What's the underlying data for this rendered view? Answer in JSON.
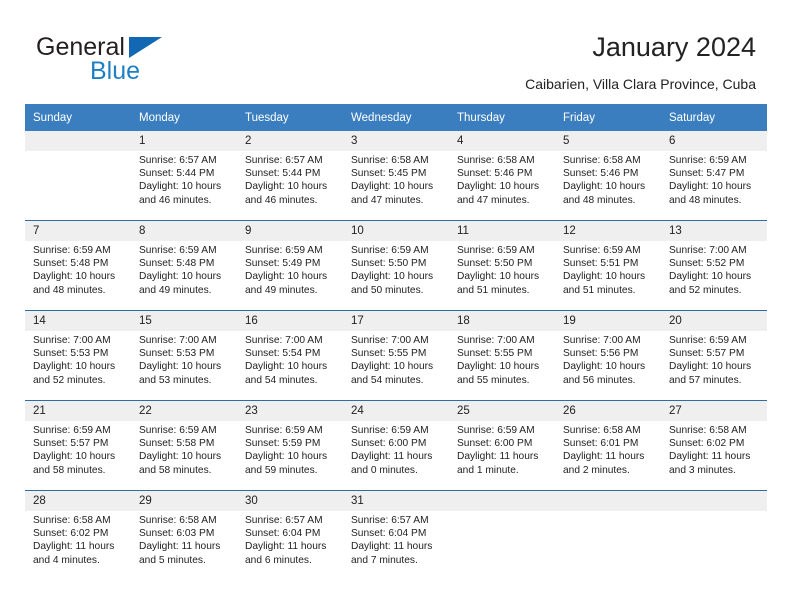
{
  "brand": {
    "name_part1": "General",
    "name_part2": "Blue",
    "accent_color": "#1f7fc4",
    "triangle_color": "#1268b3"
  },
  "header": {
    "title": "January 2024",
    "subtitle": "Caibarien, Villa Clara Province, Cuba"
  },
  "calendar": {
    "header_bg": "#3a7ebf",
    "daynum_bg": "#efefef",
    "row_border": "#2e6da4",
    "weekdays": [
      "Sunday",
      "Monday",
      "Tuesday",
      "Wednesday",
      "Thursday",
      "Friday",
      "Saturday"
    ],
    "weeks": [
      [
        {
          "day": "",
          "sunrise": "",
          "sunset": "",
          "daylight1": "",
          "daylight2": ""
        },
        {
          "day": "1",
          "sunrise": "Sunrise: 6:57 AM",
          "sunset": "Sunset: 5:44 PM",
          "daylight1": "Daylight: 10 hours",
          "daylight2": "and 46 minutes."
        },
        {
          "day": "2",
          "sunrise": "Sunrise: 6:57 AM",
          "sunset": "Sunset: 5:44 PM",
          "daylight1": "Daylight: 10 hours",
          "daylight2": "and 46 minutes."
        },
        {
          "day": "3",
          "sunrise": "Sunrise: 6:58 AM",
          "sunset": "Sunset: 5:45 PM",
          "daylight1": "Daylight: 10 hours",
          "daylight2": "and 47 minutes."
        },
        {
          "day": "4",
          "sunrise": "Sunrise: 6:58 AM",
          "sunset": "Sunset: 5:46 PM",
          "daylight1": "Daylight: 10 hours",
          "daylight2": "and 47 minutes."
        },
        {
          "day": "5",
          "sunrise": "Sunrise: 6:58 AM",
          "sunset": "Sunset: 5:46 PM",
          "daylight1": "Daylight: 10 hours",
          "daylight2": "and 48 minutes."
        },
        {
          "day": "6",
          "sunrise": "Sunrise: 6:59 AM",
          "sunset": "Sunset: 5:47 PM",
          "daylight1": "Daylight: 10 hours",
          "daylight2": "and 48 minutes."
        }
      ],
      [
        {
          "day": "7",
          "sunrise": "Sunrise: 6:59 AM",
          "sunset": "Sunset: 5:48 PM",
          "daylight1": "Daylight: 10 hours",
          "daylight2": "and 48 minutes."
        },
        {
          "day": "8",
          "sunrise": "Sunrise: 6:59 AM",
          "sunset": "Sunset: 5:48 PM",
          "daylight1": "Daylight: 10 hours",
          "daylight2": "and 49 minutes."
        },
        {
          "day": "9",
          "sunrise": "Sunrise: 6:59 AM",
          "sunset": "Sunset: 5:49 PM",
          "daylight1": "Daylight: 10 hours",
          "daylight2": "and 49 minutes."
        },
        {
          "day": "10",
          "sunrise": "Sunrise: 6:59 AM",
          "sunset": "Sunset: 5:50 PM",
          "daylight1": "Daylight: 10 hours",
          "daylight2": "and 50 minutes."
        },
        {
          "day": "11",
          "sunrise": "Sunrise: 6:59 AM",
          "sunset": "Sunset: 5:50 PM",
          "daylight1": "Daylight: 10 hours",
          "daylight2": "and 51 minutes."
        },
        {
          "day": "12",
          "sunrise": "Sunrise: 6:59 AM",
          "sunset": "Sunset: 5:51 PM",
          "daylight1": "Daylight: 10 hours",
          "daylight2": "and 51 minutes."
        },
        {
          "day": "13",
          "sunrise": "Sunrise: 7:00 AM",
          "sunset": "Sunset: 5:52 PM",
          "daylight1": "Daylight: 10 hours",
          "daylight2": "and 52 minutes."
        }
      ],
      [
        {
          "day": "14",
          "sunrise": "Sunrise: 7:00 AM",
          "sunset": "Sunset: 5:53 PM",
          "daylight1": "Daylight: 10 hours",
          "daylight2": "and 52 minutes."
        },
        {
          "day": "15",
          "sunrise": "Sunrise: 7:00 AM",
          "sunset": "Sunset: 5:53 PM",
          "daylight1": "Daylight: 10 hours",
          "daylight2": "and 53 minutes."
        },
        {
          "day": "16",
          "sunrise": "Sunrise: 7:00 AM",
          "sunset": "Sunset: 5:54 PM",
          "daylight1": "Daylight: 10 hours",
          "daylight2": "and 54 minutes."
        },
        {
          "day": "17",
          "sunrise": "Sunrise: 7:00 AM",
          "sunset": "Sunset: 5:55 PM",
          "daylight1": "Daylight: 10 hours",
          "daylight2": "and 54 minutes."
        },
        {
          "day": "18",
          "sunrise": "Sunrise: 7:00 AM",
          "sunset": "Sunset: 5:55 PM",
          "daylight1": "Daylight: 10 hours",
          "daylight2": "and 55 minutes."
        },
        {
          "day": "19",
          "sunrise": "Sunrise: 7:00 AM",
          "sunset": "Sunset: 5:56 PM",
          "daylight1": "Daylight: 10 hours",
          "daylight2": "and 56 minutes."
        },
        {
          "day": "20",
          "sunrise": "Sunrise: 6:59 AM",
          "sunset": "Sunset: 5:57 PM",
          "daylight1": "Daylight: 10 hours",
          "daylight2": "and 57 minutes."
        }
      ],
      [
        {
          "day": "21",
          "sunrise": "Sunrise: 6:59 AM",
          "sunset": "Sunset: 5:57 PM",
          "daylight1": "Daylight: 10 hours",
          "daylight2": "and 58 minutes."
        },
        {
          "day": "22",
          "sunrise": "Sunrise: 6:59 AM",
          "sunset": "Sunset: 5:58 PM",
          "daylight1": "Daylight: 10 hours",
          "daylight2": "and 58 minutes."
        },
        {
          "day": "23",
          "sunrise": "Sunrise: 6:59 AM",
          "sunset": "Sunset: 5:59 PM",
          "daylight1": "Daylight: 10 hours",
          "daylight2": "and 59 minutes."
        },
        {
          "day": "24",
          "sunrise": "Sunrise: 6:59 AM",
          "sunset": "Sunset: 6:00 PM",
          "daylight1": "Daylight: 11 hours",
          "daylight2": "and 0 minutes."
        },
        {
          "day": "25",
          "sunrise": "Sunrise: 6:59 AM",
          "sunset": "Sunset: 6:00 PM",
          "daylight1": "Daylight: 11 hours",
          "daylight2": "and 1 minute."
        },
        {
          "day": "26",
          "sunrise": "Sunrise: 6:58 AM",
          "sunset": "Sunset: 6:01 PM",
          "daylight1": "Daylight: 11 hours",
          "daylight2": "and 2 minutes."
        },
        {
          "day": "27",
          "sunrise": "Sunrise: 6:58 AM",
          "sunset": "Sunset: 6:02 PM",
          "daylight1": "Daylight: 11 hours",
          "daylight2": "and 3 minutes."
        }
      ],
      [
        {
          "day": "28",
          "sunrise": "Sunrise: 6:58 AM",
          "sunset": "Sunset: 6:02 PM",
          "daylight1": "Daylight: 11 hours",
          "daylight2": "and 4 minutes."
        },
        {
          "day": "29",
          "sunrise": "Sunrise: 6:58 AM",
          "sunset": "Sunset: 6:03 PM",
          "daylight1": "Daylight: 11 hours",
          "daylight2": "and 5 minutes."
        },
        {
          "day": "30",
          "sunrise": "Sunrise: 6:57 AM",
          "sunset": "Sunset: 6:04 PM",
          "daylight1": "Daylight: 11 hours",
          "daylight2": "and 6 minutes."
        },
        {
          "day": "31",
          "sunrise": "Sunrise: 6:57 AM",
          "sunset": "Sunset: 6:04 PM",
          "daylight1": "Daylight: 11 hours",
          "daylight2": "and 7 minutes."
        },
        {
          "day": "",
          "sunrise": "",
          "sunset": "",
          "daylight1": "",
          "daylight2": ""
        },
        {
          "day": "",
          "sunrise": "",
          "sunset": "",
          "daylight1": "",
          "daylight2": ""
        },
        {
          "day": "",
          "sunrise": "",
          "sunset": "",
          "daylight1": "",
          "daylight2": ""
        }
      ]
    ]
  }
}
